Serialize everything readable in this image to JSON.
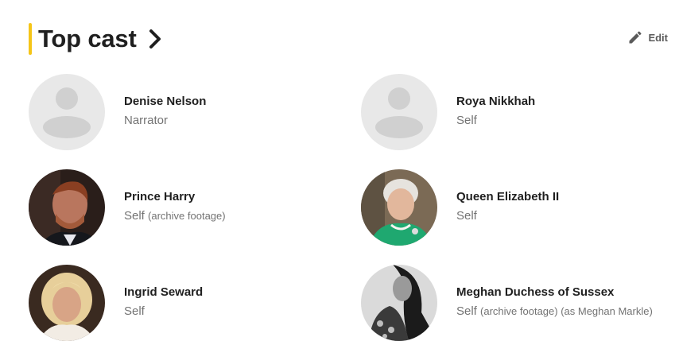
{
  "section": {
    "title": "Top cast",
    "edit_label": "Edit",
    "accent_color": "#f5c518"
  },
  "cast": [
    {
      "name": "Denise Nelson",
      "role": "Narrator",
      "note": "",
      "avatar": "placeholder"
    },
    {
      "name": "Roya Nikkhah",
      "role": "Self",
      "note": "",
      "avatar": "placeholder"
    },
    {
      "name": "Prince Harry",
      "role": "Self",
      "note": "(archive footage)",
      "avatar": "photo"
    },
    {
      "name": "Queen Elizabeth II",
      "role": "Self",
      "note": "",
      "avatar": "photo"
    },
    {
      "name": "Ingrid Seward",
      "role": "Self",
      "note": "",
      "avatar": "photo"
    },
    {
      "name": "Meghan Duchess of Sussex",
      "role": "Self",
      "note": "(archive footage) (as Meghan Markle)",
      "avatar": "photo"
    }
  ],
  "icons": {
    "title_chevron": "chevron-right-icon",
    "edit": "pencil-icon",
    "placeholder_avatar": "person-placeholder-icon"
  }
}
